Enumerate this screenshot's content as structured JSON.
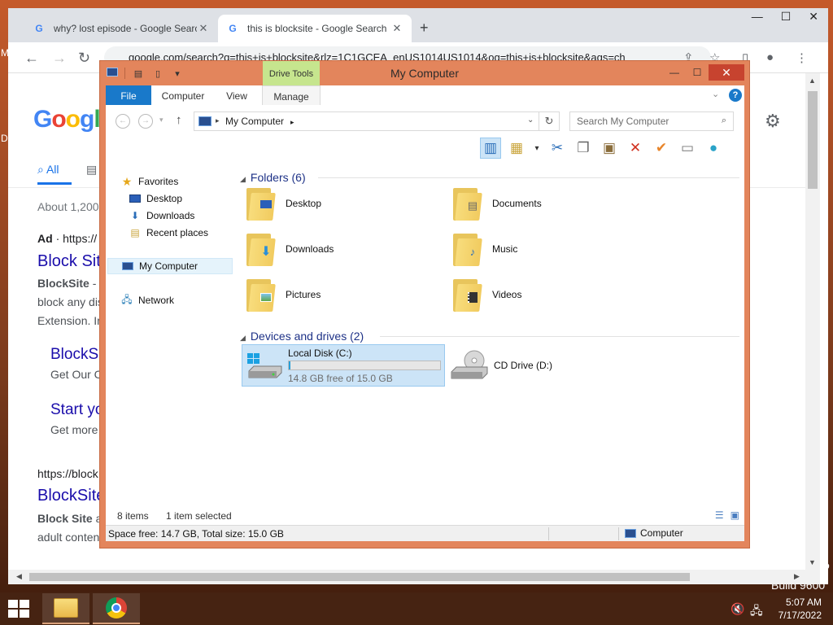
{
  "desktop": {
    "build_text": "Build 9600",
    "partial_left_1": "M",
    "partial_left_2": "D",
    "partial_right": "o"
  },
  "chrome": {
    "tabs": [
      {
        "title": "why? lost episode - Google Searc",
        "icon": "google-g-icon",
        "active": false
      },
      {
        "title": "this is blocksite - Google Search",
        "icon": "google-g-icon",
        "active": true
      }
    ],
    "url": "google.com/search?q=this+is+blocksite&rlz=1C1GCEA_enUS1014US1014&oq=this+is+blocksite&aqs=ch",
    "page": {
      "logo": [
        "G",
        "o",
        "o",
        "g",
        "l"
      ],
      "tab_all": "All",
      "results_count": "About 1,200",
      "ad_label": "Ad",
      "ad_url": "· https://",
      "result1_title": "Block Sit",
      "result1_snippet_bold": "BlockSite",
      "result1_snippet_rest": " - T",
      "result1_line2": "block any dis",
      "result1_line3": "Extension. In",
      "sitelink1_title": "BlockS",
      "sitelink1_snippet": "Get Our C",
      "sitelink2_title": "Start yo",
      "sitelink2_snippet": "Get more",
      "result2_url": "https://block",
      "result2_title": "BlockSite",
      "result2_snippet_bold": "Block Site",
      "result2_snippet_rest": " a",
      "result2_line2": "adult conten"
    }
  },
  "explorer": {
    "title": "My Computer",
    "contextual_tab": "Drive Tools",
    "ribbon_tabs": [
      "File",
      "Computer",
      "View",
      "Manage"
    ],
    "address": "My Computer",
    "search_placeholder": "Search My Computer",
    "nav": {
      "favorites": "Favorites",
      "desktop": "Desktop",
      "downloads": "Downloads",
      "recent": "Recent places",
      "my_computer": "My Computer",
      "network": "Network"
    },
    "folders_header": "Folders (6)",
    "folders": [
      {
        "name": "Desktop",
        "icon": "desktop-folder-icon"
      },
      {
        "name": "Documents",
        "icon": "documents-folder-icon"
      },
      {
        "name": "Downloads",
        "icon": "downloads-folder-icon"
      },
      {
        "name": "Music",
        "icon": "music-folder-icon"
      },
      {
        "name": "Pictures",
        "icon": "pictures-folder-icon"
      },
      {
        "name": "Videos",
        "icon": "videos-folder-icon"
      }
    ],
    "devices_header": "Devices and drives (2)",
    "local_disk": {
      "name": "Local Disk (C:)",
      "free_text": "14.8 GB free of 15.0 GB",
      "used_fraction": 0.013
    },
    "cd_drive": {
      "name": "CD Drive (D:)"
    },
    "status": {
      "items": "8 items",
      "selected": "1 item selected",
      "space": "Space free: 14.7 GB, Total size: 15.0 GB",
      "location": "Computer"
    },
    "colors": {
      "frame": "#e3855c",
      "close": "#c7432f",
      "file_tab": "#1979ca",
      "drive_tools": "#c6e58e",
      "selection": "#cce4f7"
    }
  },
  "taskbar": {
    "time": "5:07 AM",
    "date": "7/17/2022",
    "apps": [
      "file-explorer-icon",
      "chrome-icon"
    ]
  }
}
